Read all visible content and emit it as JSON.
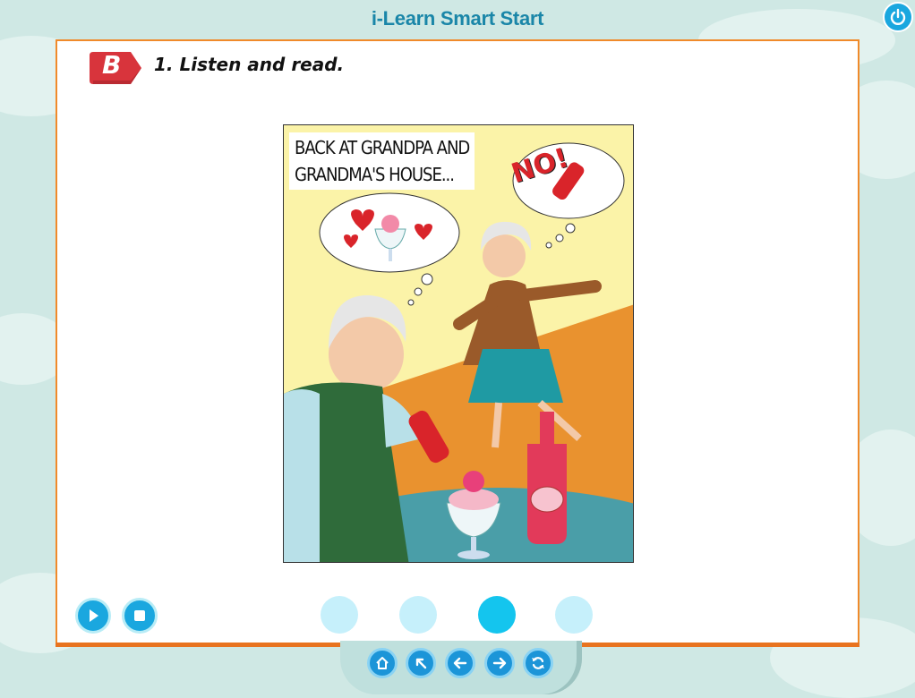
{
  "app": {
    "title": "i-Learn Smart Start"
  },
  "lesson": {
    "section_letter": "B",
    "instruction": "1. Listen and read."
  },
  "comic": {
    "caption_line1": "BACK AT GRANDPA AND",
    "caption_line2": "GRANDMA'S HOUSE...",
    "speech_text": "NO!"
  },
  "audio_controls": [
    "play-icon",
    "stop-icon"
  ],
  "pages": {
    "count": 4,
    "active_index": 2
  },
  "nav_buttons": [
    "home-icon",
    "back-to-menu-icon",
    "previous-icon",
    "next-icon",
    "replay-icon"
  ],
  "colors": {
    "accent_blue": "#1aa7df",
    "panel_border": "#f08a2a",
    "title_color": "#1a86a8",
    "badge_red": "#d8343c"
  }
}
